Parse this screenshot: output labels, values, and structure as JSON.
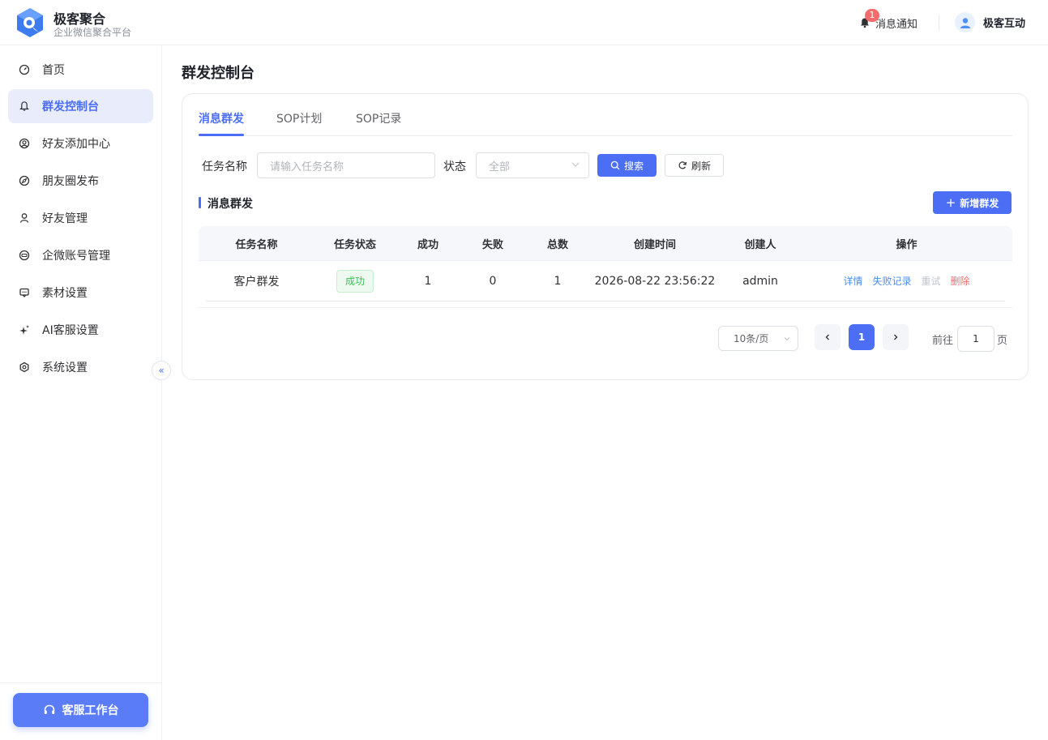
{
  "app": {
    "title": "极客聚合",
    "subtitle": "企业微信聚合平台"
  },
  "header": {
    "notification_label": "消息通知",
    "notification_count": "1",
    "user_name": "极客互动"
  },
  "sidebar": {
    "items": [
      {
        "label": "首页",
        "icon": "dashboard-icon"
      },
      {
        "label": "群发控制台",
        "icon": "bell-icon",
        "active": true
      },
      {
        "label": "好友添加中心",
        "icon": "user-add-icon"
      },
      {
        "label": "朋友圈发布",
        "icon": "compass-icon"
      },
      {
        "label": "好友管理",
        "icon": "user-icon"
      },
      {
        "label": "企微账号管理",
        "icon": "account-icon"
      },
      {
        "label": "素材设置",
        "icon": "chat-box-icon"
      },
      {
        "label": "AI客服设置",
        "icon": "sparkle-icon"
      },
      {
        "label": "系统设置",
        "icon": "gear-icon"
      }
    ],
    "service_button": "客服工作台"
  },
  "main": {
    "page_title": "群发控制台",
    "tabs": [
      {
        "label": "消息群发",
        "active": true
      },
      {
        "label": "SOP计划"
      },
      {
        "label": "SOP记录"
      }
    ],
    "filters": {
      "task_name_label": "任务名称",
      "task_name_placeholder": "请输入任务名称",
      "status_label": "状态",
      "status_value": "全部",
      "search_label": "搜索",
      "refresh_label": "刷新"
    },
    "section_title": "消息群发",
    "new_button": "新增群发",
    "table": {
      "columns": [
        "任务名称",
        "任务状态",
        "成功",
        "失败",
        "总数",
        "创建时间",
        "创建人",
        "操作"
      ],
      "rows": [
        {
          "name": "客户群发",
          "status": "成功",
          "success": "1",
          "failed": "0",
          "total": "1",
          "created_at": "2026-08-22 23:56:22",
          "creator": "admin",
          "actions": [
            "详情",
            "失败记录",
            "重试",
            "删除"
          ]
        }
      ]
    },
    "pagination": {
      "page_size": "10条/页",
      "current_page": "1",
      "goto_prefix": "前往",
      "goto_value": "1",
      "goto_suffix": "页"
    }
  },
  "colors": {
    "primary": "#4b6ef5",
    "success": "#3cbf5a",
    "danger": "#f56c6c",
    "muted": "#c0c4cc"
  }
}
